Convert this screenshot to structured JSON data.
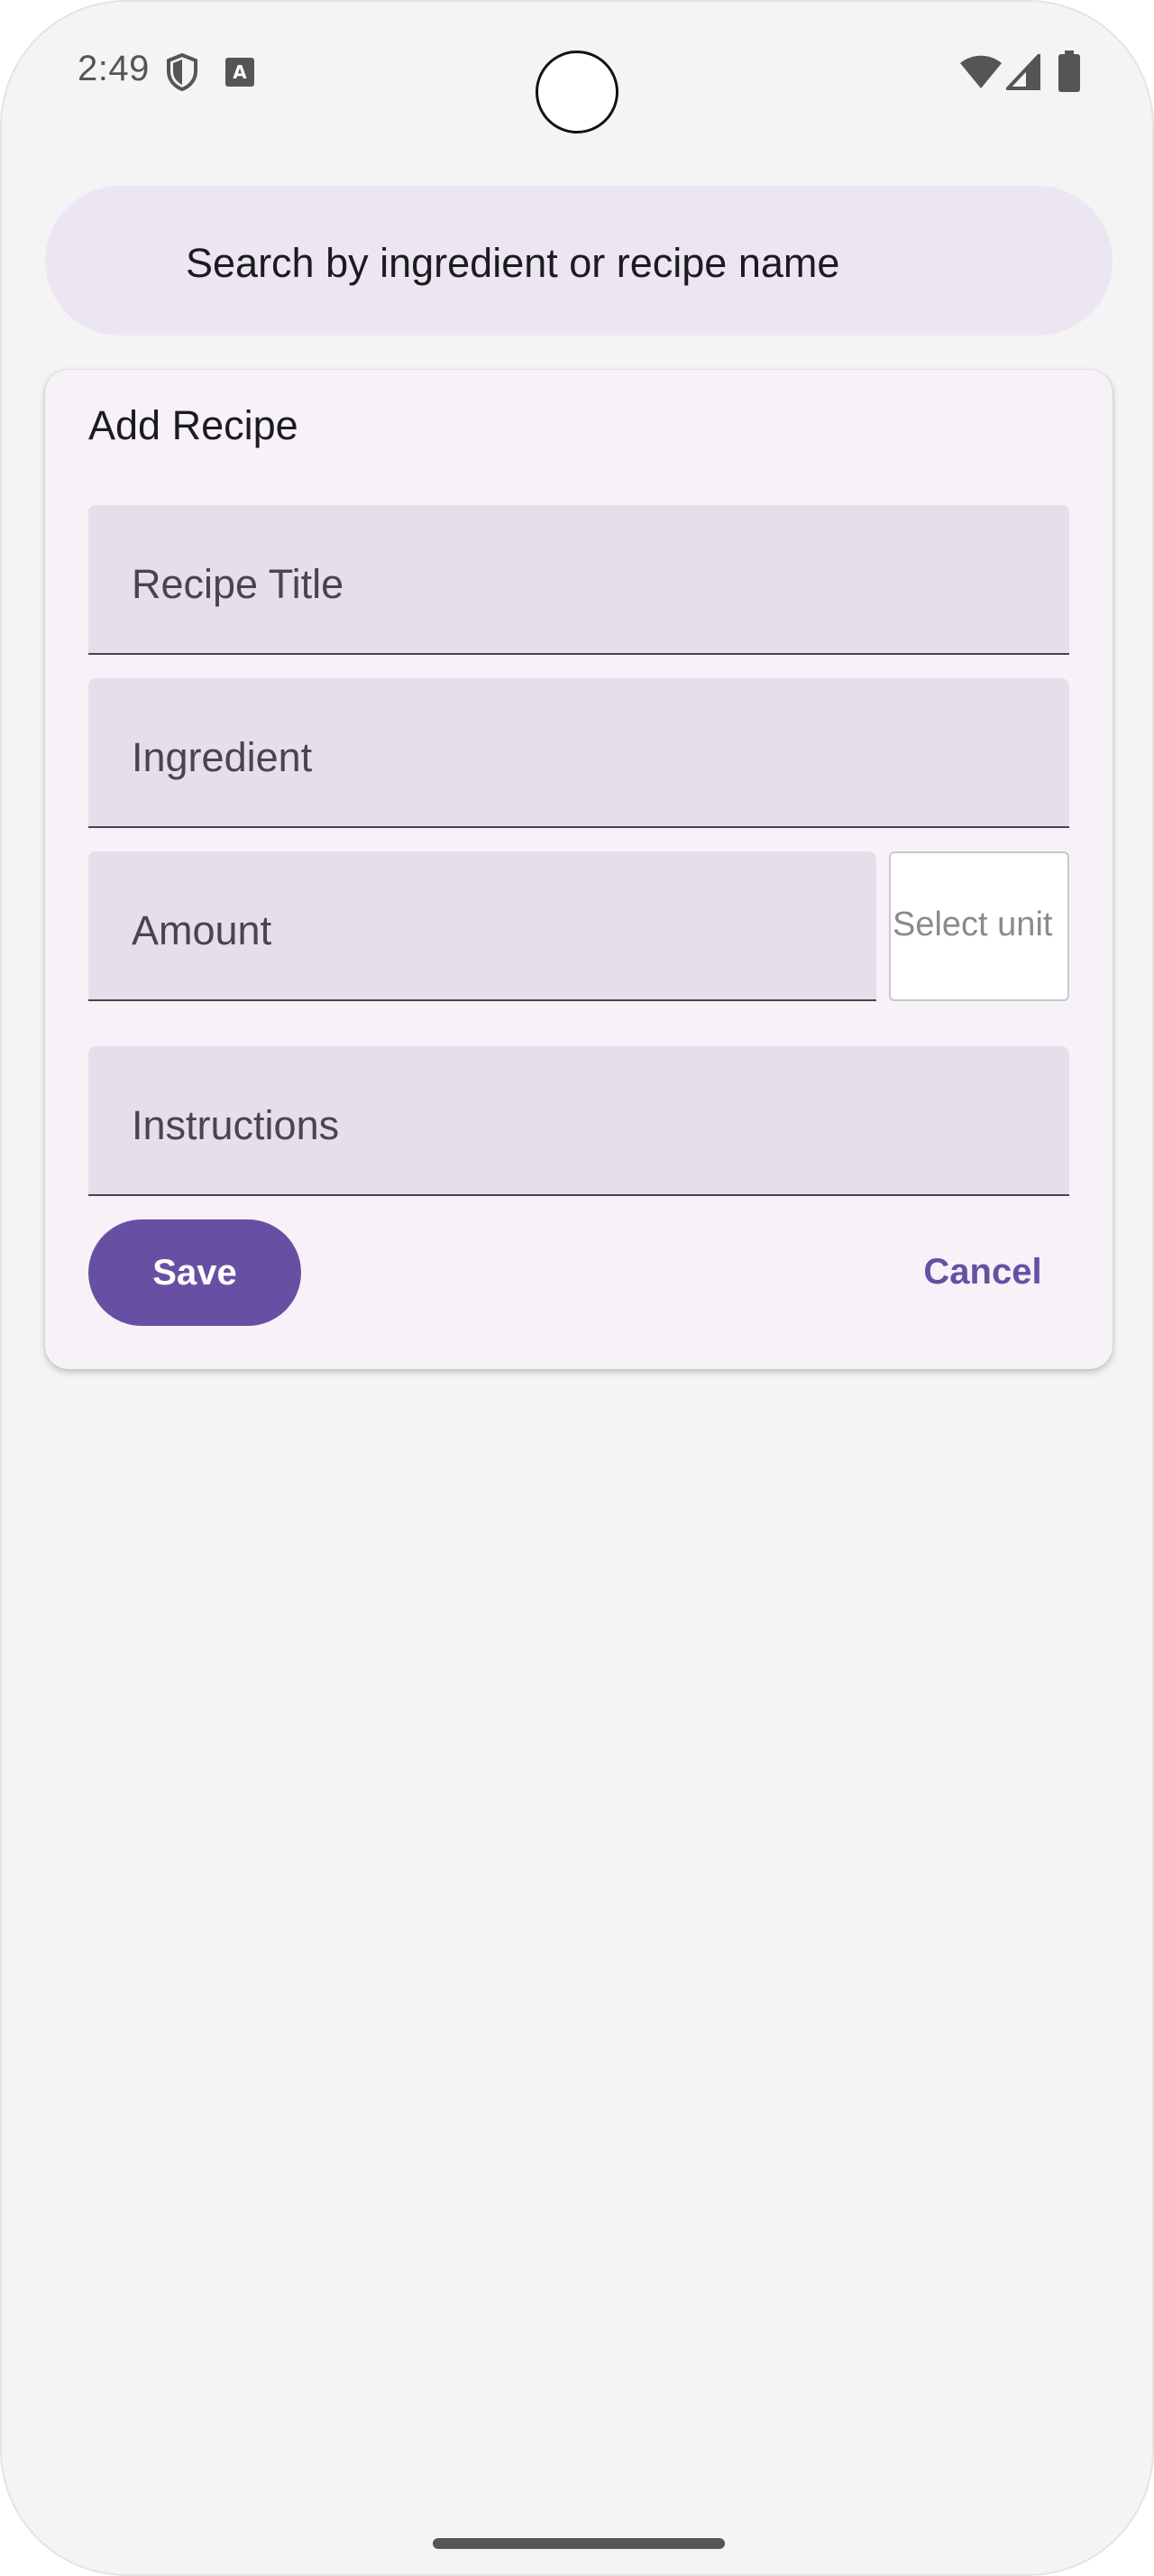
{
  "status_bar": {
    "time": "2:49",
    "icons": [
      "shield-icon",
      "text-a-icon",
      "wifi-icon",
      "signal-icon",
      "battery-icon"
    ]
  },
  "search": {
    "placeholder": "Search by ingredient or recipe name"
  },
  "dialog": {
    "title": "Add Recipe",
    "fields": {
      "recipe_title": "Recipe Title",
      "ingredient": "Ingredient",
      "amount": "Amount",
      "unit_select": "Select unit",
      "instructions": "Instructions"
    },
    "actions": {
      "save": "Save",
      "cancel": "Cancel"
    }
  },
  "colors": {
    "primary": "#6750a4",
    "field_bg": "#e6dfeb",
    "card_bg": "#f7f2f8",
    "search_bg": "#ece6f2",
    "screen_bg": "#f4f4f4"
  }
}
